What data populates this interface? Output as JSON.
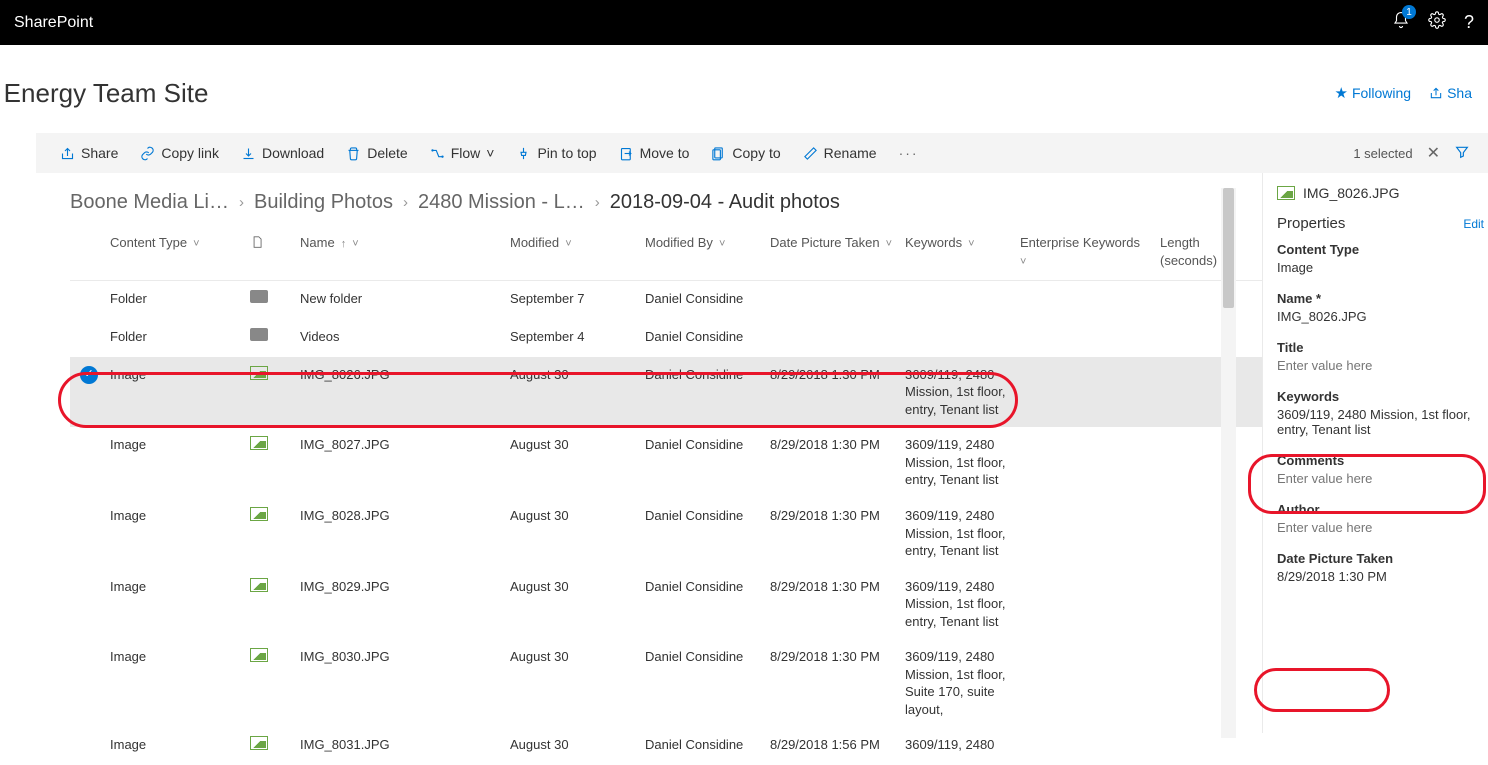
{
  "topbar": {
    "app": "SharePoint",
    "notif_count": "1"
  },
  "siteheader": {
    "title": "e Energy Team Site",
    "follow": "Following",
    "share": "Sha"
  },
  "cmdbar": {
    "share": "Share",
    "copylink": "Copy link",
    "download": "Download",
    "delete": "Delete",
    "flow": "Flow",
    "pintotop": "Pin to top",
    "moveto": "Move to",
    "copyto": "Copy to",
    "rename": "Rename",
    "selected": "1 selected"
  },
  "breadcrumb": {
    "c0": "Boone Media Li…",
    "c1": "Building Photos",
    "c2": "2480 Mission - L…",
    "c3": "2018-09-04 - Audit photos"
  },
  "columns": {
    "contentType": "Content Type",
    "name": "Name",
    "modified": "Modified",
    "modifiedBy": "Modified By",
    "datePicture": "Date Picture Taken",
    "keywords": "Keywords",
    "entKeywords": "Enterprise Keywords",
    "length": "Length (seconds)"
  },
  "rows": [
    {
      "sel": false,
      "ctype": "Folder",
      "icon": "folder",
      "name": "New folder",
      "modified": "September 7",
      "by": "Daniel Considine",
      "date": "",
      "kw": ""
    },
    {
      "sel": false,
      "ctype": "Folder",
      "icon": "folder",
      "name": "Videos",
      "modified": "September 4",
      "by": "Daniel Considine",
      "date": "",
      "kw": ""
    },
    {
      "sel": true,
      "ctype": "Image",
      "icon": "image",
      "name": "IMG_8026.JPG",
      "modified": "August 30",
      "by": "Daniel Considine",
      "date": "8/29/2018 1:30 PM",
      "kw": "3609/119, 2480 Mission, 1st floor, entry, Tenant list"
    },
    {
      "sel": false,
      "ctype": "Image",
      "icon": "image",
      "name": "IMG_8027.JPG",
      "modified": "August 30",
      "by": "Daniel Considine",
      "date": "8/29/2018 1:30 PM",
      "kw": "3609/119, 2480 Mission, 1st floor, entry, Tenant list"
    },
    {
      "sel": false,
      "ctype": "Image",
      "icon": "image",
      "name": "IMG_8028.JPG",
      "modified": "August 30",
      "by": "Daniel Considine",
      "date": "8/29/2018 1:30 PM",
      "kw": "3609/119, 2480 Mission, 1st floor, entry, Tenant list"
    },
    {
      "sel": false,
      "ctype": "Image",
      "icon": "image",
      "name": "IMG_8029.JPG",
      "modified": "August 30",
      "by": "Daniel Considine",
      "date": "8/29/2018 1:30 PM",
      "kw": "3609/119, 2480 Mission, 1st floor, entry, Tenant list"
    },
    {
      "sel": false,
      "ctype": "Image",
      "icon": "image",
      "name": "IMG_8030.JPG",
      "modified": "August 30",
      "by": "Daniel Considine",
      "date": "8/29/2018 1:30 PM",
      "kw": "3609/119, 2480 Mission, 1st floor, Suite 170, suite layout,"
    },
    {
      "sel": false,
      "ctype": "Image",
      "icon": "image",
      "name": "IMG_8031.JPG",
      "modified": "August 30",
      "by": "Daniel Considine",
      "date": "8/29/2018 1:56 PM",
      "kw": "3609/119, 2480"
    }
  ],
  "details": {
    "filename": "IMG_8026.JPG",
    "props_label": "Properties",
    "edit": "Edit",
    "contentType_label": "Content Type",
    "contentType_val": "Image",
    "name_label": "Name *",
    "name_val": "IMG_8026.JPG",
    "title_label": "Title",
    "title_val": "Enter value here",
    "keywords_label": "Keywords",
    "keywords_val": "3609/119, 2480 Mission, 1st floor, entry, Tenant list",
    "comments_label": "Comments",
    "comments_val": "Enter value here",
    "author_label": "Author",
    "author_val": "Enter value here",
    "datepic_label": "Date Picture Taken",
    "datepic_val": "8/29/2018 1:30 PM"
  }
}
